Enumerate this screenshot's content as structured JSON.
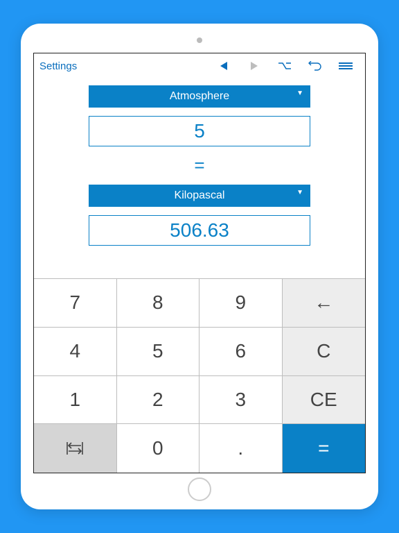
{
  "toolbar": {
    "settings_label": "Settings"
  },
  "conversion": {
    "from_unit": "Atmosphere",
    "from_value": "5",
    "equals": "=",
    "to_unit": "Kilopascal",
    "to_value": "506.63"
  },
  "keypad": {
    "k7": "7",
    "k8": "8",
    "k9": "9",
    "back": "←",
    "k4": "4",
    "k5": "5",
    "k6": "6",
    "clear": "C",
    "k1": "1",
    "k2": "2",
    "k3": "3",
    "clear_entry": "CE",
    "k0": "0",
    "dot": ".",
    "equals": "="
  }
}
